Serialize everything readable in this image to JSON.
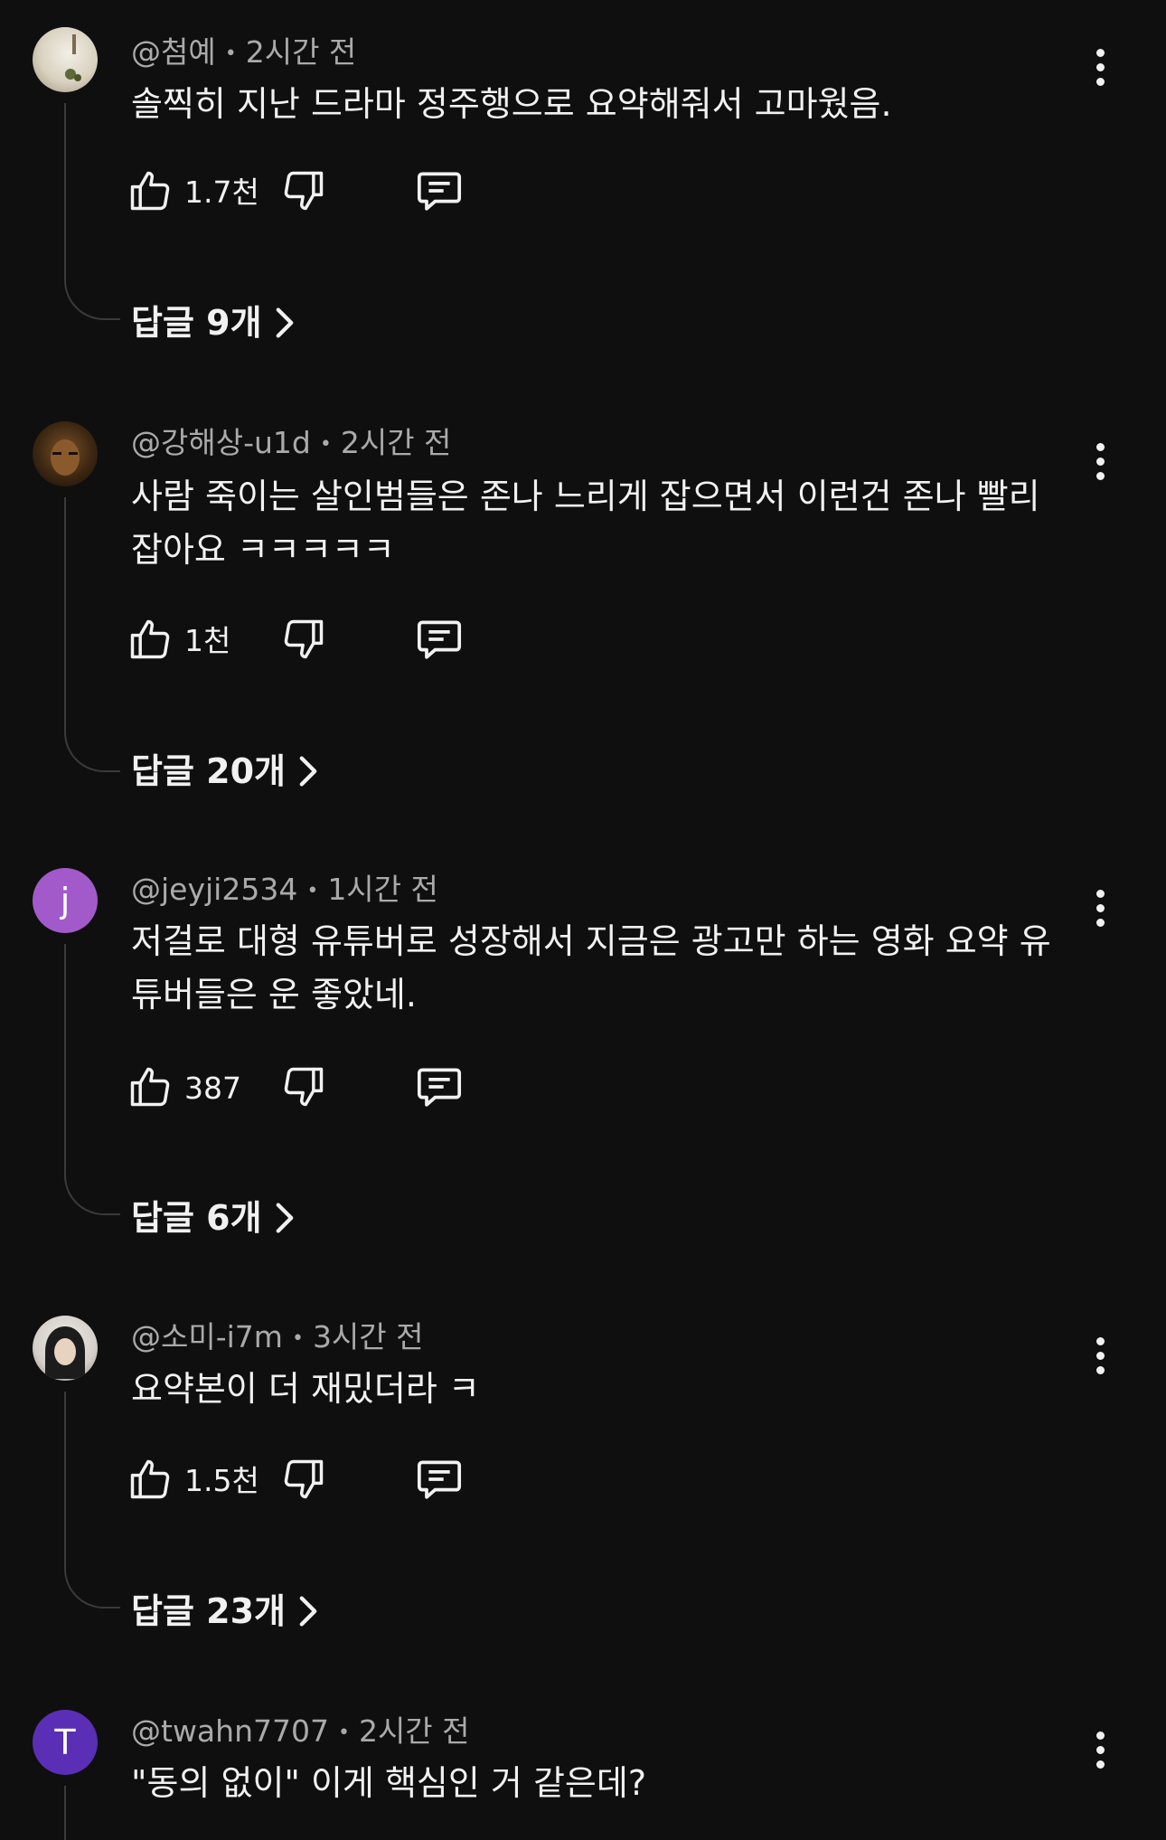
{
  "comments": [
    {
      "author": "@첨예",
      "time": "2시간 전",
      "text_lines": [
        "솔찍히 지난 드라마 정주행으로 요약해줘서 고마웠음."
      ],
      "likes": "1.7천",
      "replies": "답글 9개",
      "avatar": {
        "type": "photo",
        "colors": [
          "#e9e4d8",
          "#b9ad93"
        ]
      }
    },
    {
      "author": "@강해상-u1d",
      "time": "2시간 전",
      "text_lines": [
        "사람 죽이는 살인범들은 존나 느리게 잡으면서 이런건 존나 빨리",
        "잡아요 ㅋㅋㅋㅋㅋ"
      ],
      "likes": "1천",
      "replies": "답글 20개",
      "avatar": {
        "type": "photo",
        "colors": [
          "#5a3a1c",
          "#1e130a"
        ]
      }
    },
    {
      "author": "@jeyji2534",
      "time": "1시간 전",
      "text_lines": [
        "저걸로 대형 유튜버로 성장해서 지금은 광고만 하는 영화 요약 유",
        "튜버들은 운 좋았네."
      ],
      "likes": "387",
      "replies": "답글 6개",
      "avatar": {
        "type": "letter",
        "letter": "j",
        "color": "#a25acb"
      }
    },
    {
      "author": "@소미-i7m",
      "time": "3시간 전",
      "text_lines": [
        "요약본이 더 재밌더라 ㅋ"
      ],
      "likes": "1.5천",
      "replies": "답글 23개",
      "avatar": {
        "type": "photo",
        "colors": [
          "#e0ddd8",
          "#2a2a2a"
        ]
      }
    },
    {
      "author": "@twahn7707",
      "time": "2시간 전",
      "text_lines": [
        "\"동의 없이\" 이게 핵심인 거 같은데?"
      ],
      "avatar": {
        "type": "letter",
        "letter": "T",
        "color": "#5b2fb5"
      }
    }
  ],
  "icons": {
    "like": "thumbs-up-icon",
    "dislike": "thumbs-down-icon",
    "reply": "comment-icon",
    "more": "more-vert-icon",
    "chevron": "chevron-right-icon"
  },
  "colors": {
    "background": "#0f0f0f",
    "text": "#f1f1f1",
    "meta": "#aaaaaa",
    "thread_line": "#3a3a3a"
  }
}
